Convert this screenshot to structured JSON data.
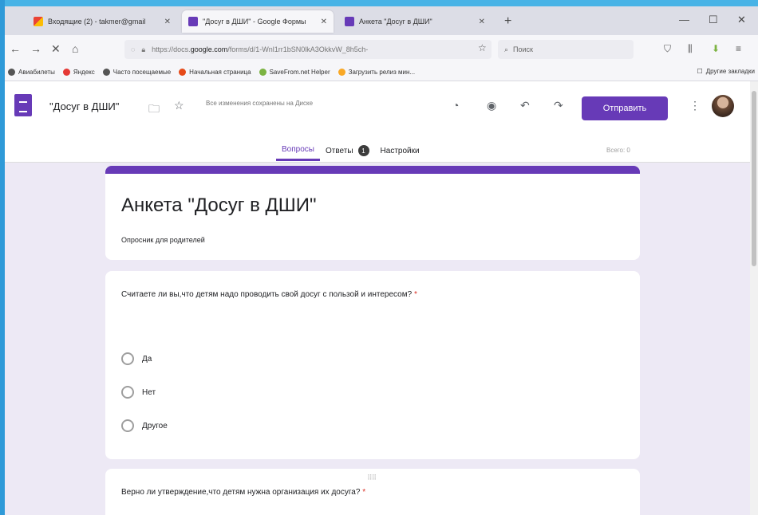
{
  "browser": {
    "tabs": [
      {
        "label": "Входящие (2) - takmer@gmail",
        "icon": "gmail-icon"
      },
      {
        "label": "\"Досуг в ДШИ\" - Google Формы",
        "icon": "forms-icon"
      },
      {
        "label": "Анкета \"Досуг в ДШИ\"",
        "icon": "forms-icon"
      }
    ],
    "url_prefix": "https://docs.",
    "url_domain": "google.com",
    "url_rest": "/forms/d/1-Wnl1rr1bSN0lkA3OkkvW_8h5ch-",
    "search_placeholder": "Поиск",
    "bookmarks": [
      {
        "label": "Авиабилеты",
        "color": "#555555"
      },
      {
        "label": "Яндекс",
        "color": "#e53935"
      },
      {
        "label": "Часто посещаемые",
        "color": "#555555"
      },
      {
        "label": "Начальная страница",
        "color": "#e64a19"
      },
      {
        "label": "SaveFrom.net Helper",
        "color": "#7cb342"
      },
      {
        "label": "Загрузить релиз мин...",
        "color": "#f9a825"
      }
    ],
    "other_bookmarks": "Другие закладки"
  },
  "forms": {
    "doc_title": "\"Досуг в ДШИ\"",
    "save_status": "Все изменения сохранены на Диске",
    "send_label": "Отправить",
    "tabs": [
      {
        "label": "Вопросы"
      },
      {
        "label": "Ответы"
      },
      {
        "label": "Настройки"
      }
    ],
    "responses_badge": "1",
    "total": "Всего: 0",
    "accent": "#673ab7"
  },
  "form": {
    "title": "Анкета  \"Досуг в ДШИ\"",
    "description": "Опросник для родителей",
    "questions": [
      {
        "text": "Считаете ли вы,что детям надо проводить свой досуг с пользой и интересом?",
        "required_mark": "*",
        "options": [
          "Да",
          "Нет",
          "Другое"
        ]
      },
      {
        "text": "Верно ли утверждение,что детям нужна организация их досуга?",
        "required_mark": "*"
      }
    ]
  }
}
